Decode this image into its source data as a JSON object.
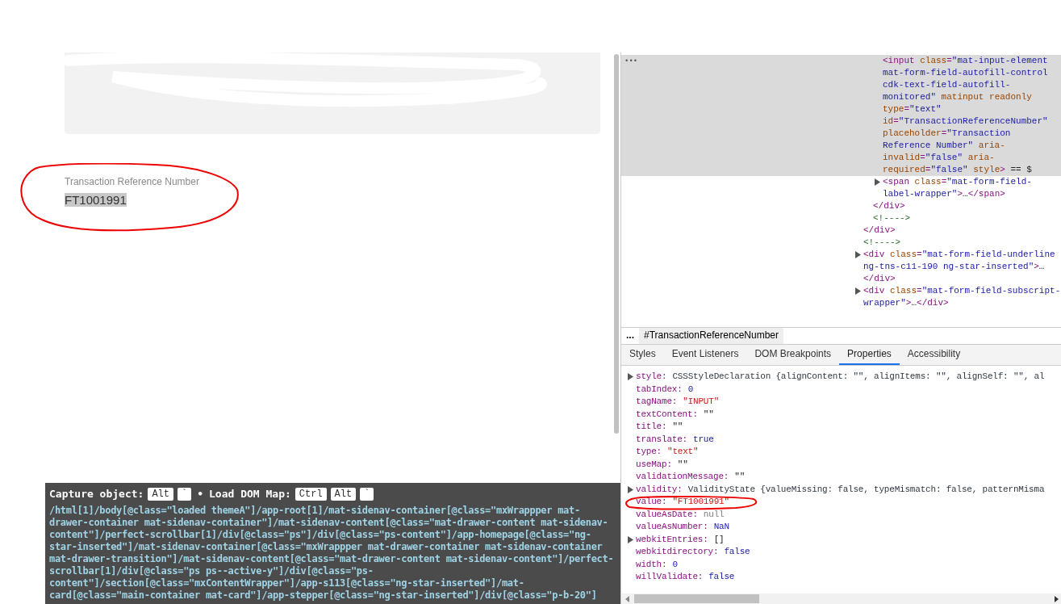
{
  "page": {
    "field": {
      "label": "Transaction Reference Number",
      "value": "FT1001991"
    }
  },
  "devtools": {
    "elements": {
      "more": "•••",
      "tree": [
        {
          "children": [
            {
              "children": [
                {
                  "selected": true,
                  "expandable": false,
                  "tokens": [
                    {
                      "kind": "tag",
                      "t": "<input"
                    },
                    {
                      "kind": "attr",
                      "t": " class"
                    },
                    {
                      "kind": "tag",
                      "t": "="
                    },
                    {
                      "kind": "val",
                      "t": "\"mat-input-element mat-form-field-autofill-control cdk-text-field-autofill-monitored\""
                    },
                    {
                      "kind": "attr",
                      "t": " matinput readonly type"
                    },
                    {
                      "kind": "tag",
                      "t": "="
                    },
                    {
                      "kind": "val",
                      "t": "\"text\""
                    },
                    {
                      "kind": "attr",
                      "t": " id"
                    },
                    {
                      "kind": "tag",
                      "t": "="
                    },
                    {
                      "kind": "val",
                      "t": "\"TransactionReferenceNumber\""
                    },
                    {
                      "kind": "attr",
                      "t": " placeholder"
                    },
                    {
                      "kind": "tag",
                      "t": "="
                    },
                    {
                      "kind": "val",
                      "t": "\"Transaction Reference Number\""
                    },
                    {
                      "kind": "attr",
                      "t": " aria-invalid"
                    },
                    {
                      "kind": "tag",
                      "t": "="
                    },
                    {
                      "kind": "val",
                      "t": "\"false\""
                    },
                    {
                      "kind": "attr",
                      "t": " aria-required"
                    },
                    {
                      "kind": "tag",
                      "t": "="
                    },
                    {
                      "kind": "val",
                      "t": "\"false\""
                    },
                    {
                      "kind": "attr",
                      "t": " style"
                    },
                    {
                      "kind": "tag",
                      "t": ">"
                    },
                    {
                      "kind": "plain",
                      "t": " == $"
                    }
                  ]
                },
                {
                  "selected": false,
                  "expandable": true,
                  "tokens": [
                    {
                      "kind": "tag",
                      "t": "<span"
                    },
                    {
                      "kind": "attr",
                      "t": " class"
                    },
                    {
                      "kind": "tag",
                      "t": "="
                    },
                    {
                      "kind": "val",
                      "t": "\"mat-form-field-label-wrapper\""
                    },
                    {
                      "kind": "tag",
                      "t": ">"
                    },
                    {
                      "kind": "plain",
                      "t": "…"
                    },
                    {
                      "kind": "tag",
                      "t": "</span>"
                    }
                  ]
                }
              ],
              "close": [
                {
                  "kind": "tag",
                  "t": "</div>"
                }
              ]
            },
            {
              "selected": false,
              "expandable": false,
              "tokens": [
                {
                  "kind": "comment",
                  "t": "<!---->"
                }
              ]
            }
          ],
          "close": [
            {
              "kind": "tag",
              "t": "</div>"
            }
          ]
        },
        {
          "selected": false,
          "expandable": false,
          "tokens": [
            {
              "kind": "comment",
              "t": "<!---->"
            }
          ]
        },
        {
          "selected": false,
          "expandable": true,
          "tokens": [
            {
              "kind": "tag",
              "t": "<div"
            },
            {
              "kind": "attr",
              "t": " class"
            },
            {
              "kind": "tag",
              "t": "="
            },
            {
              "kind": "val",
              "t": "\"mat-form-field-underline ng-tns-c11-190 ng-star-inserted\""
            },
            {
              "kind": "tag",
              "t": ">"
            },
            {
              "kind": "plain",
              "t": "…"
            },
            {
              "kind": "tag",
              "t": "</div>"
            }
          ]
        },
        {
          "selected": false,
          "expandable": true,
          "tokens": [
            {
              "kind": "tag",
              "t": "<div"
            },
            {
              "kind": "attr",
              "t": " class"
            },
            {
              "kind": "tag",
              "t": "="
            },
            {
              "kind": "val",
              "t": "\"mat-form-field-subscript-wrapper\""
            },
            {
              "kind": "tag",
              "t": ">"
            },
            {
              "kind": "plain",
              "t": "…"
            },
            {
              "kind": "tag",
              "t": "</div>"
            }
          ]
        }
      ]
    },
    "breadcrumb": {
      "more": "...",
      "items": [
        {
          "label": "#TransactionReferenceNumber",
          "selected": true
        }
      ]
    },
    "tabs": [
      {
        "label": "Styles",
        "selected": false
      },
      {
        "label": "Event Listeners",
        "selected": false
      },
      {
        "label": "DOM Breakpoints",
        "selected": false
      },
      {
        "label": "Properties",
        "selected": true
      },
      {
        "label": "Accessibility",
        "selected": false
      }
    ],
    "properties": [
      {
        "name": "style:",
        "value": "CSSStyleDeclaration {alignContent: \"\", alignItems: \"\", alignSelf: \"\", al",
        "kind": "object",
        "expandable": true
      },
      {
        "name": "tabIndex:",
        "value": "0",
        "kind": "number",
        "expandable": false
      },
      {
        "name": "tagName:",
        "value": "\"INPUT\"",
        "kind": "string",
        "expandable": false
      },
      {
        "name": "textContent:",
        "value": "\"\"",
        "kind": "plain",
        "expandable": false
      },
      {
        "name": "title:",
        "value": "\"\"",
        "kind": "plain",
        "expandable": false
      },
      {
        "name": "translate:",
        "value": "true",
        "kind": "number",
        "expandable": false
      },
      {
        "name": "type:",
        "value": "\"text\"",
        "kind": "string",
        "expandable": false
      },
      {
        "name": "useMap:",
        "value": "\"\"",
        "kind": "plain",
        "expandable": false
      },
      {
        "name": "validationMessage:",
        "value": "\"\"",
        "kind": "plain",
        "expandable": false
      },
      {
        "name": "validity:",
        "value": "ValidityState {valueMissing: false, typeMismatch: false, patternMisma",
        "kind": "object",
        "expandable": true
      },
      {
        "name": "value:",
        "value": "\"FT1001991\"",
        "kind": "string",
        "expandable": false
      },
      {
        "name": "valueAsDate:",
        "value": "null",
        "kind": "null",
        "expandable": false
      },
      {
        "name": "valueAsNumber:",
        "value": "NaN",
        "kind": "number",
        "expandable": false
      },
      {
        "name": "webkitEntries:",
        "value": "[]",
        "kind": "plain",
        "expandable": true
      },
      {
        "name": "webkitdirectory:",
        "value": "false",
        "kind": "number",
        "expandable": false
      },
      {
        "name": "width:",
        "value": "0",
        "kind": "number",
        "expandable": false
      },
      {
        "name": "willValidate:",
        "value": "false",
        "kind": "number",
        "expandable": false
      }
    ]
  },
  "capture_overlay": {
    "hotkeys": [
      {
        "label": "Capture object:",
        "keys": [
          "Alt",
          "`"
        ]
      },
      {
        "label": "Load DOM Map:",
        "keys": [
          "Ctrl",
          "Alt",
          "`"
        ]
      }
    ],
    "separator": "•",
    "xpath": "/html[1]/body[@class=\"loaded themeA\"]/app-root[1]/mat-sidenav-container[@class=\"mxWrappper mat-drawer-container mat-sidenav-container\"]/mat-sidenav-content[@class=\"mat-drawer-content mat-sidenav-content\"]/perfect-scrollbar[1]/div[@class=\"ps\"]/div[@class=\"ps-content\"]/app-homepage[@class=\"ng-star-inserted\"]/mat-sidenav-container[@class=\"mxWrappper mat-drawer-container mat-sidenav-container mat-drawer-transition\"]/mat-sidenav-content[@class=\"mat-drawer-content mat-sidenav-content\"]/perfect-scrollbar[1]/div[@class=\"ps ps--active-y\"]/div[@class=\"ps-content\"]/section[@class=\"mxContentWrapper\"]/app-s113[@class=\"ng-star-inserted\"]/mat-card[@class=\"main-container mat-card\"]/app-stepper[@class=\"ng-star-inserted\"]/div[@class=\"p-b-20\"]"
  }
}
